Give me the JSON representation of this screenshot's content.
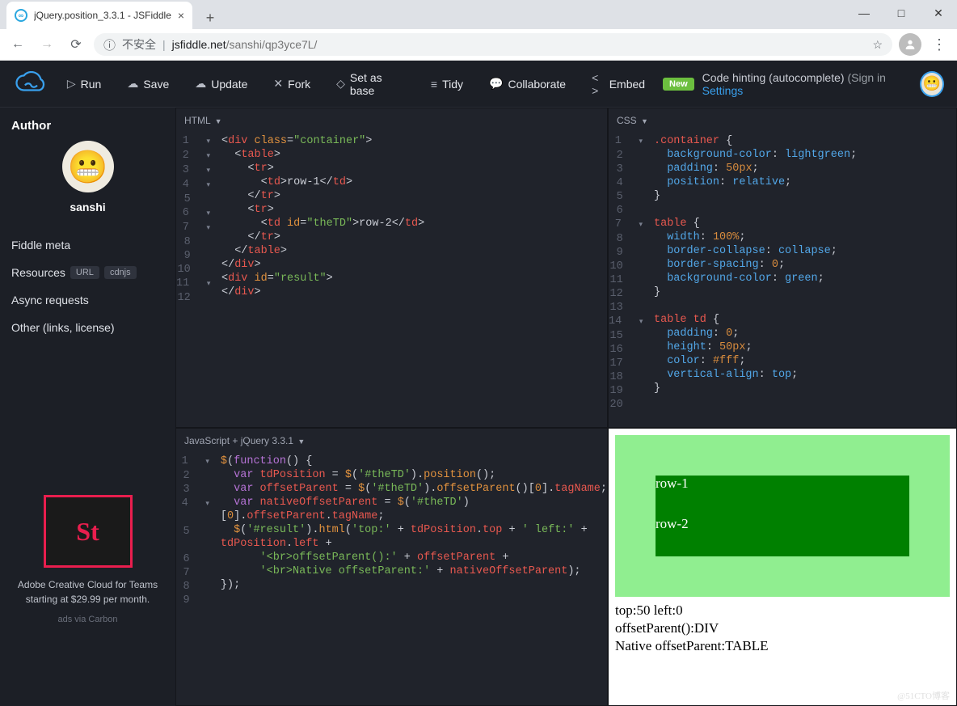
{
  "browser": {
    "tab_title": "jQuery.position_3.3.1 - JSFiddle",
    "url_warn": "不安全",
    "url_host": "jsfiddle.net",
    "url_path": "/sanshi/qp3yce7L/"
  },
  "toolbar": {
    "run": "Run",
    "save": "Save",
    "update": "Update",
    "fork": "Fork",
    "setbase": "Set as base",
    "tidy": "Tidy",
    "collab": "Collaborate",
    "embed": "Embed",
    "new_badge": "New",
    "hint": "Code hinting (autocomplete)",
    "sign": "Sign in",
    "settings": "Settings"
  },
  "sidebar": {
    "author_h": "Author",
    "author_name": "sanshi",
    "meta": "Fiddle meta",
    "resources": "Resources",
    "url": "URL",
    "cdnjs": "cdnjs",
    "async": "Async requests",
    "other": "Other (links, license)",
    "ad_logo": "St",
    "ad_text": "Adobe Creative Cloud for Teams starting at $29.99 per month.",
    "ad_via": "ads via Carbon"
  },
  "panes": {
    "html_label": "HTML",
    "css_label": "CSS",
    "js_label": "JavaScript + jQuery 3.3.1"
  },
  "html_code": {
    "l1": "<div class=\"container\">",
    "l2": "  <table>",
    "l3": "    <tr>",
    "l4": "      <td>row-1</td>",
    "l5": "    </tr>",
    "l6": "    <tr>",
    "l7": "      <td id=\"theTD\">row-2</td>",
    "l8": "    </tr>",
    "l9": "  </table>",
    "l10": "</div>",
    "l11": "<div id=\"result\">",
    "l12": "</div>"
  },
  "css_code": {
    "l1": ".container {",
    "l2": "  background-color: lightgreen;",
    "l3": "  padding: 50px;",
    "l4": "  position: relative;",
    "l5": "}",
    "l6": "",
    "l7": "table {",
    "l8": "  width: 100%;",
    "l9": "  border-collapse: collapse;",
    "l10": "  border-spacing: 0;",
    "l11": "  background-color: green;",
    "l12": "}",
    "l13": "",
    "l14": "table td {",
    "l15": "  padding: 0;",
    "l16": "  height: 50px;",
    "l17": "  color: #fff;",
    "l18": "  vertical-align: top;",
    "l19": "}",
    "l20": ""
  },
  "js_code": {
    "raw": "$(function() {\n  var tdPosition = $('#theTD').position();\n  var offsetParent = $('#theTD').offsetParent()[0].tagName;\n  var nativeOffsetParent = $('#theTD')[0].offsetParent.tagName;\n  $('#result').html('top:' + tdPosition.top + ' left:' + tdPosition.left +\n      '<br>offsetParent():' + offsetParent +\n      '<br>Native offsetParent:' + nativeOffsetParent);\n});"
  },
  "result": {
    "row1": "row-1",
    "row2": "row-2",
    "line1": "top:50 left:0",
    "line2": "offsetParent():DIV",
    "line3": "Native offsetParent:TABLE"
  },
  "watermark": "@51CTO博客"
}
